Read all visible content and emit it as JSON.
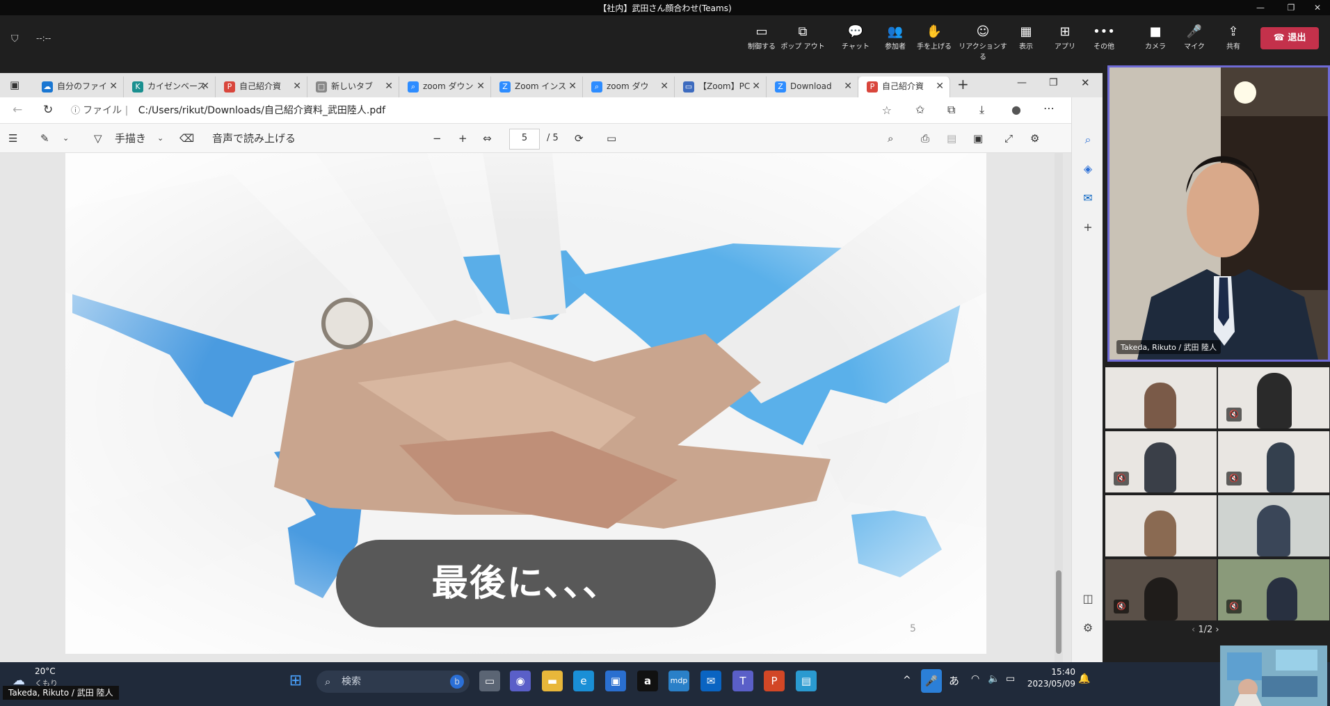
{
  "window": {
    "title": "【社内】武田さん顔合わせ(Teams)"
  },
  "meeting": {
    "timer": "--:--",
    "controls": [
      {
        "label": "制御する",
        "icon": "share-control-icon"
      },
      {
        "label": "ポップ アウト",
        "icon": "popout-icon"
      },
      {
        "label": "チャット",
        "icon": "chat-icon"
      },
      {
        "label": "参加者",
        "icon": "people-icon"
      },
      {
        "label": "手を上げる",
        "icon": "hand-icon"
      },
      {
        "label": "リアクションする",
        "icon": "smile-icon"
      },
      {
        "label": "表示",
        "icon": "grid-icon"
      },
      {
        "label": "アプリ",
        "icon": "plus-square-icon"
      },
      {
        "label": "その他",
        "icon": "more-icon"
      },
      {
        "label": "カメラ",
        "icon": "camera-icon"
      },
      {
        "label": "マイク",
        "icon": "mic-icon"
      },
      {
        "label": "共有",
        "icon": "share-icon"
      }
    ],
    "leave_label": "退出"
  },
  "browser": {
    "tabs": [
      {
        "label": "自分のファイ",
        "color": "#1976d2",
        "glyph": "☁"
      },
      {
        "label": "カイゼンベース",
        "color": "#1a8f8f",
        "glyph": "K"
      },
      {
        "label": "自己紹介資",
        "color": "#d9463c",
        "glyph": "P"
      },
      {
        "label": "新しいタブ",
        "color": "#777777",
        "glyph": "□"
      },
      {
        "label": "zoom ダウン",
        "color": "#2d8cff",
        "glyph": "🔍"
      },
      {
        "label": "Zoom インス",
        "color": "#2d8cff",
        "glyph": "Z"
      },
      {
        "label": "zoom ダウ",
        "color": "#2d8cff",
        "glyph": "🔍"
      },
      {
        "label": "【Zoom】PC",
        "color": "#3d6bbf",
        "glyph": "▭"
      },
      {
        "label": "Download",
        "color": "#2d8cff",
        "glyph": "Z"
      },
      {
        "label": "自己紹介資",
        "color": "#d9463c",
        "glyph": "P"
      }
    ],
    "address_prefix": "ファイル",
    "url": "C:/Users/rikut/Downloads/自己紹介資料_武田陸人.pdf"
  },
  "pdf": {
    "draw_label": "手描き",
    "read_aloud": "音声で読み上げる",
    "page_current": "5",
    "page_total": "/ 5",
    "caption": "最後に、、、",
    "page_number": "5"
  },
  "video": {
    "main_name": "Takeda, Rikuto / 武田 陸人",
    "paging": "1/2"
  },
  "taskbar": {
    "weather_temp": "20°C",
    "weather_desc": "くもり",
    "search_placeholder": "検索",
    "ime": "あ",
    "time": "15:40",
    "date": "2023/05/09"
  },
  "overlay_name": "Takeda, Rikuto / 武田 陸人"
}
